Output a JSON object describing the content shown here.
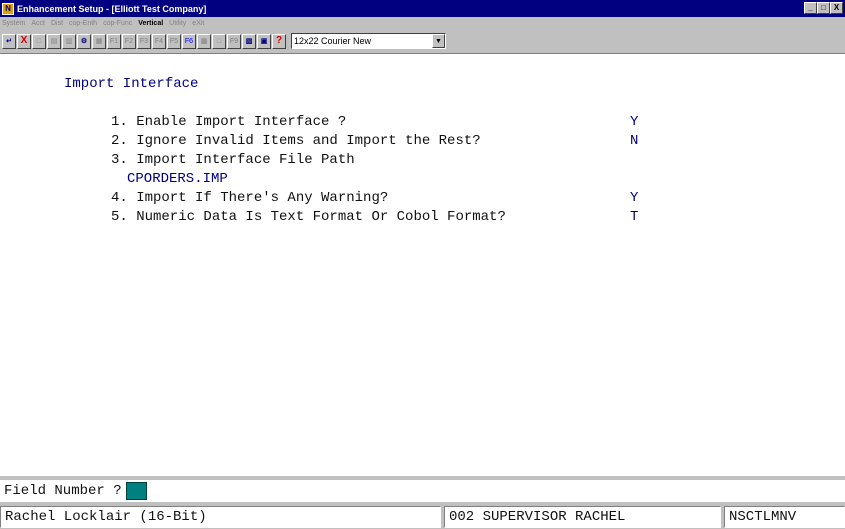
{
  "window": {
    "title": "Enhancement Setup - [Elliott Test Company]",
    "icon_letter": "N",
    "buttons": [
      "_",
      "□",
      "X"
    ]
  },
  "menu": [
    "System",
    "Acct",
    "Dist",
    "cop-Enth",
    "cop-Func",
    "Vertical",
    "Utility",
    "eXit"
  ],
  "toolbar": {
    "buttons": [
      "↵",
      "X",
      "□",
      "▤",
      "▥",
      "⚙",
      "▦",
      "F1",
      "F2",
      "F3",
      "F4",
      "F5",
      "F6",
      "▩",
      "□",
      "F9",
      "▧",
      "▣",
      "?"
    ],
    "font_value": "12x22 Courier New"
  },
  "screen": {
    "heading": "Import Interface",
    "fields": [
      {
        "label": "1. Enable Import Interface ?",
        "value": "Y"
      },
      {
        "label": "2. Ignore Invalid Items and Import the Rest?",
        "value": "N"
      },
      {
        "label": "3. Import Interface File Path",
        "value": "CPORDERS.IMP"
      },
      {
        "label": "4. Import If There's Any Warning?",
        "value": "Y"
      },
      {
        "label": "5. Numeric Data Is Text Format Or Cobol Format?",
        "value": "T"
      }
    ]
  },
  "prompt": {
    "label": "Field Number ?"
  },
  "status": {
    "user": "Rachel Locklair (16-Bit)",
    "role": "002 SUPERVISOR RACHEL",
    "program": "NSCTLMNV"
  }
}
